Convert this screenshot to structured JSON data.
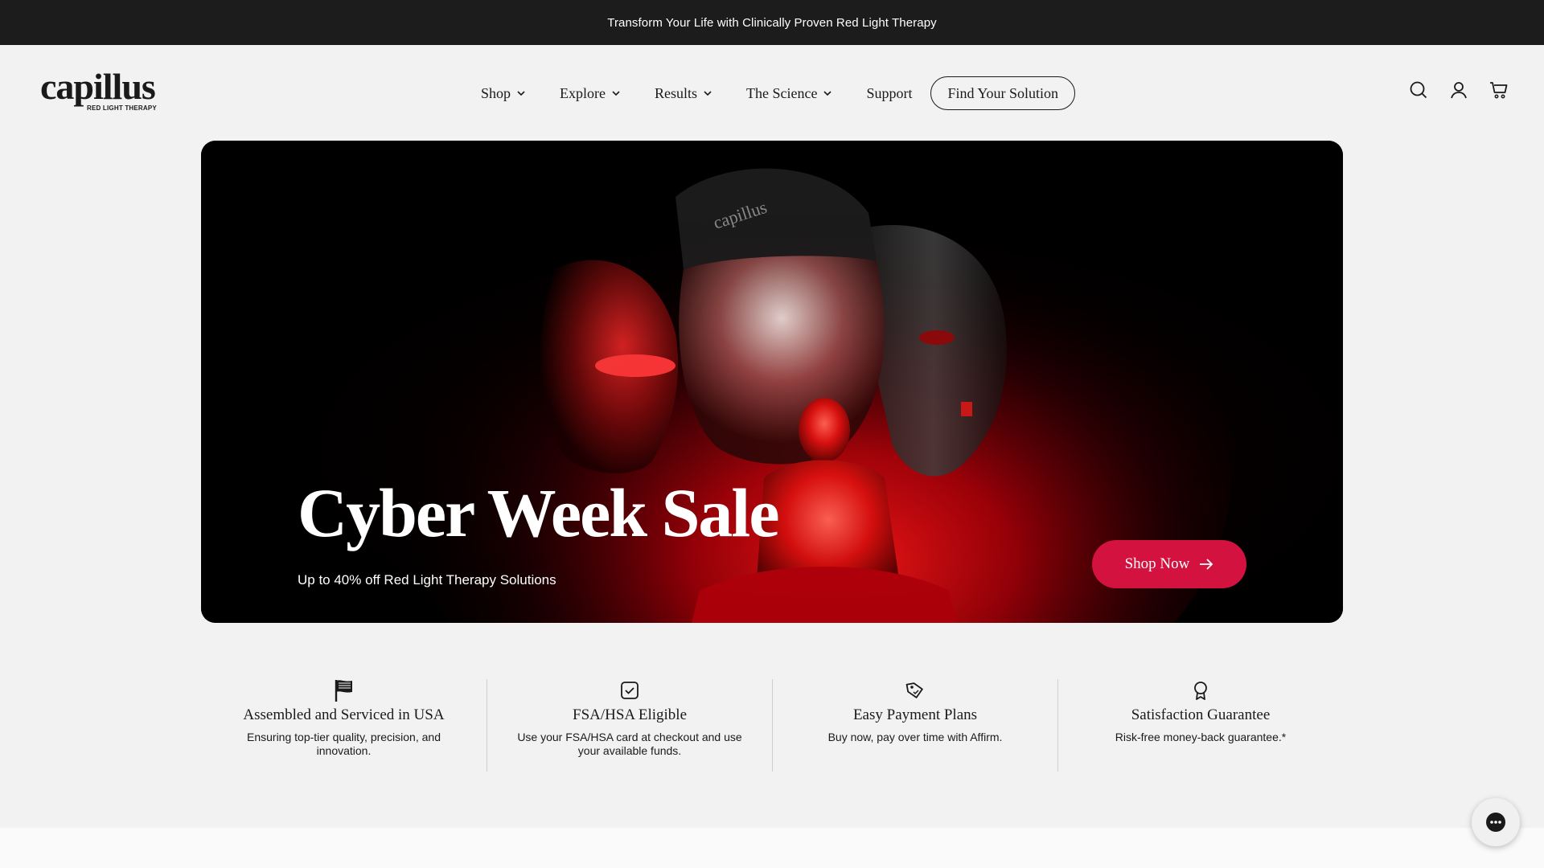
{
  "announcement": {
    "text": "Transform Your Life with Clinically Proven Red Light Therapy"
  },
  "logo": {
    "wordmark": "capillus",
    "tagline": "RED LIGHT THERAPY"
  },
  "nav": {
    "items": [
      {
        "label": "Shop",
        "has_dropdown": true
      },
      {
        "label": "Explore",
        "has_dropdown": true
      },
      {
        "label": "Results",
        "has_dropdown": true
      },
      {
        "label": "The Science",
        "has_dropdown": true
      },
      {
        "label": "Support",
        "has_dropdown": false
      }
    ],
    "cta": "Find Your Solution"
  },
  "header_icons": [
    "search-icon",
    "account-icon",
    "cart-icon"
  ],
  "hero": {
    "title": "Cyber Week Sale",
    "subtitle": "Up to 40% off Red Light Therapy Solutions",
    "button": "Shop Now",
    "accent_color": "#d3123f",
    "cap_text": "capillus"
  },
  "features": [
    {
      "icon": "flag-icon",
      "title": "Assembled and Serviced in USA",
      "desc": "Ensuring top-tier quality, precision, and innovation."
    },
    {
      "icon": "check-badge-icon",
      "title": "FSA/HSA Eligible",
      "desc": "Use your FSA/HSA card at checkout and use your available funds."
    },
    {
      "icon": "price-tag-icon",
      "title": "Easy Payment Plans",
      "desc": "Buy now, pay over time with Affirm."
    },
    {
      "icon": "award-ribbon-icon",
      "title": "Satisfaction Guarantee",
      "desc": "Risk-free money-back guarantee.*"
    }
  ],
  "chat": {
    "icon": "chat-bubble-icon"
  }
}
